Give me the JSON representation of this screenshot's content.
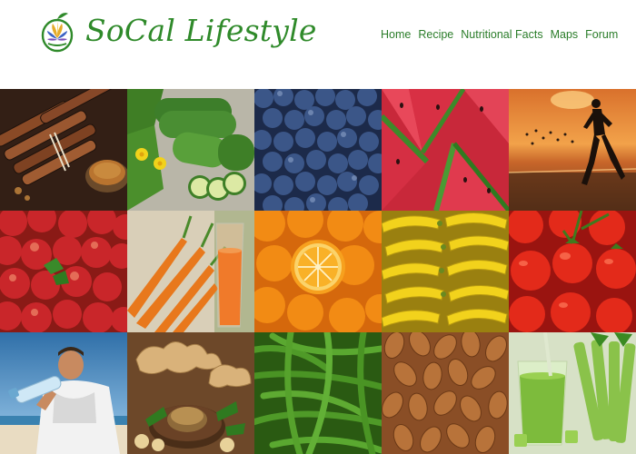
{
  "header": {
    "brand": "SoCal Lifestyle",
    "logo_icon": "lotus-leaf-icon",
    "brand_color": "#2f8a2a"
  },
  "nav": {
    "items": [
      {
        "label": "Home"
      },
      {
        "label": "Recipe"
      },
      {
        "label": "Nutritional Facts"
      },
      {
        "label": "Maps"
      },
      {
        "label": "Forum"
      }
    ],
    "color": "#2b7d2a"
  },
  "gallery": {
    "tiles": [
      {
        "subject": "cinnamon"
      },
      {
        "subject": "cucumbers"
      },
      {
        "subject": "blueberries"
      },
      {
        "subject": "watermelon"
      },
      {
        "subject": "beach-runner"
      },
      {
        "subject": "apples"
      },
      {
        "subject": "carrots"
      },
      {
        "subject": "oranges"
      },
      {
        "subject": "bananas"
      },
      {
        "subject": "tomatoes"
      },
      {
        "subject": "man-drinking-water"
      },
      {
        "subject": "ginger"
      },
      {
        "subject": "green-beans"
      },
      {
        "subject": "almonds"
      },
      {
        "subject": "green-smoothie"
      }
    ]
  }
}
